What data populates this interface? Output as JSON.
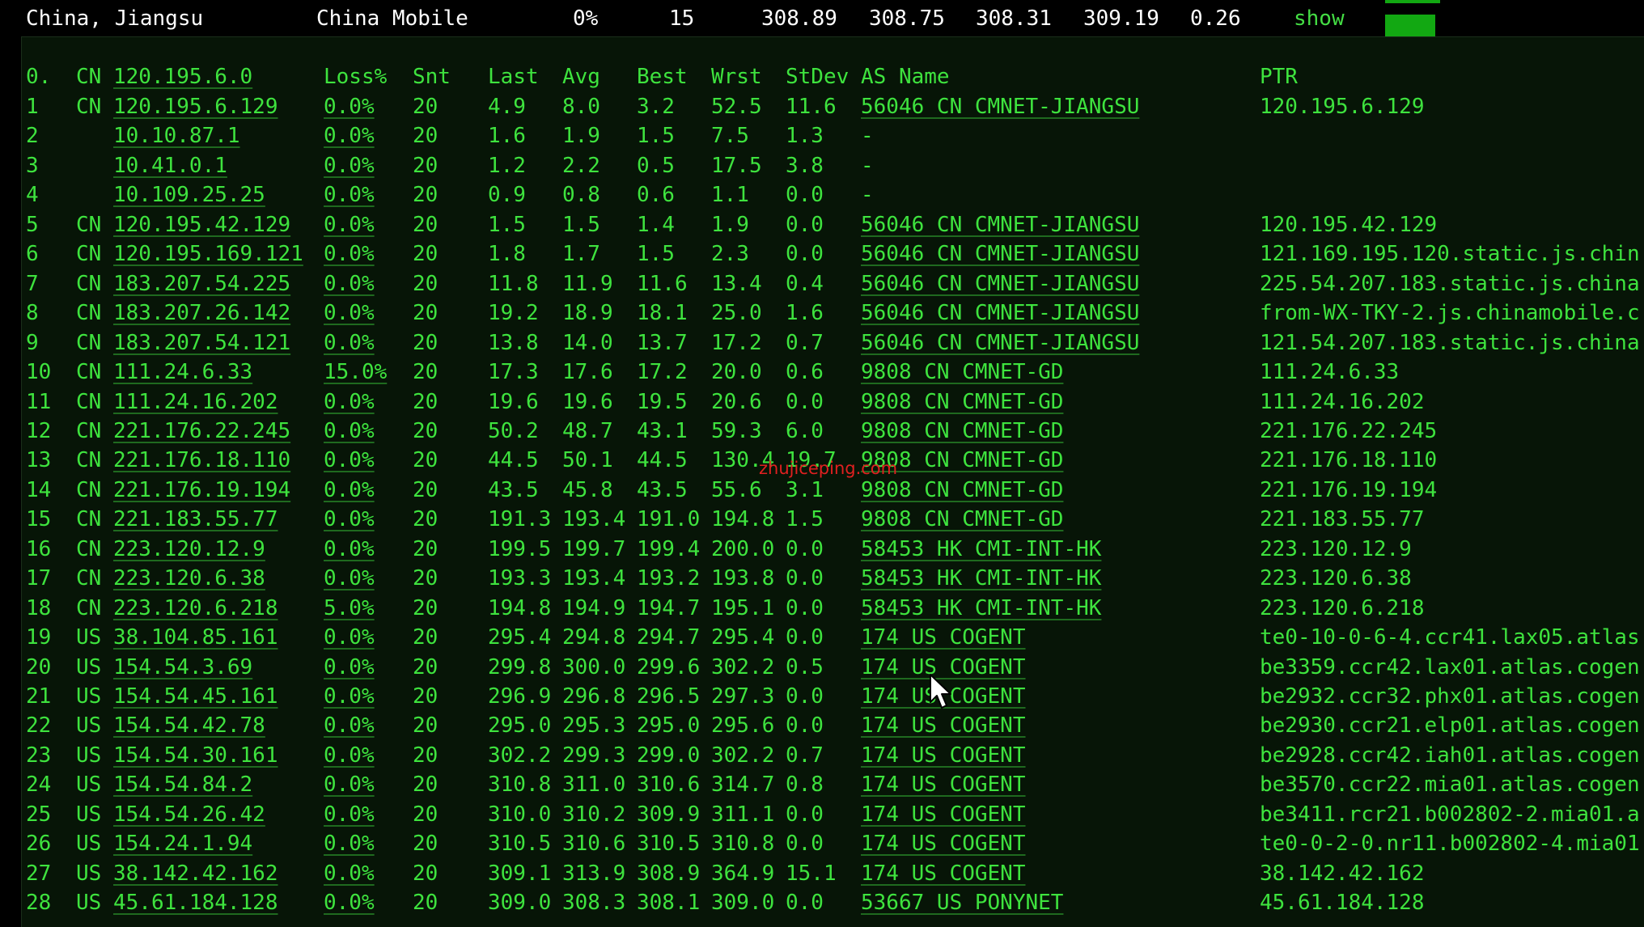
{
  "summary": {
    "location": "China, Jiangsu",
    "isp": "China Mobile",
    "loss": "0%",
    "sent": "15",
    "last": "308.89",
    "avg": "308.75",
    "best": "308.31",
    "worst": "309.19",
    "stdev": "0.26",
    "show_label": "show",
    "accent": "#12a812"
  },
  "trace": {
    "header": {
      "hop": "0.",
      "cc": "CN",
      "ip": "120.195.6.0",
      "loss": "Loss%",
      "snt": "Snt",
      "last": "Last",
      "avg": "Avg",
      "best": "Best",
      "wrst": "Wrst",
      "stdev": "StDev",
      "as": "AS Name",
      "ptr": "PTR"
    },
    "rows": [
      [
        "1",
        "CN",
        "120.195.6.129",
        "0.0%",
        "20",
        "4.9",
        "8.0",
        "3.2",
        "52.5",
        "11.6",
        "56046 CN CMNET-JIANGSU",
        "120.195.6.129"
      ],
      [
        "2",
        "",
        "10.10.87.1",
        "0.0%",
        "20",
        "1.6",
        "1.9",
        "1.5",
        "7.5",
        "1.3",
        "-",
        ""
      ],
      [
        "3",
        "",
        "10.41.0.1",
        "0.0%",
        "20",
        "1.2",
        "2.2",
        "0.5",
        "17.5",
        "3.8",
        "-",
        ""
      ],
      [
        "4",
        "",
        "10.109.25.25",
        "0.0%",
        "20",
        "0.9",
        "0.8",
        "0.6",
        "1.1",
        "0.0",
        "-",
        ""
      ],
      [
        "5",
        "CN",
        "120.195.42.129",
        "0.0%",
        "20",
        "1.5",
        "1.5",
        "1.4",
        "1.9",
        "0.0",
        "56046 CN CMNET-JIANGSU",
        "120.195.42.129"
      ],
      [
        "6",
        "CN",
        "120.195.169.121",
        "0.0%",
        "20",
        "1.8",
        "1.7",
        "1.5",
        "2.3",
        "0.0",
        "56046 CN CMNET-JIANGSU",
        "121.169.195.120.static.js.chin"
      ],
      [
        "7",
        "CN",
        "183.207.54.225",
        "0.0%",
        "20",
        "11.8",
        "11.9",
        "11.6",
        "13.4",
        "0.4",
        "56046 CN CMNET-JIANGSU",
        "225.54.207.183.static.js.china"
      ],
      [
        "8",
        "CN",
        "183.207.26.142",
        "0.0%",
        "20",
        "19.2",
        "18.9",
        "18.1",
        "25.0",
        "1.6",
        "56046 CN CMNET-JIANGSU",
        "from-WX-TKY-2.js.chinamobile.c"
      ],
      [
        "9",
        "CN",
        "183.207.54.121",
        "0.0%",
        "20",
        "13.8",
        "14.0",
        "13.7",
        "17.2",
        "0.7",
        "56046 CN CMNET-JIANGSU",
        "121.54.207.183.static.js.china"
      ],
      [
        "10",
        "CN",
        "111.24.6.33",
        "15.0%",
        "20",
        "17.3",
        "17.6",
        "17.2",
        "20.0",
        "0.6",
        "9808  CN CMNET-GD",
        "111.24.6.33"
      ],
      [
        "11",
        "CN",
        "111.24.16.202",
        "0.0%",
        "20",
        "19.6",
        "19.6",
        "19.5",
        "20.6",
        "0.0",
        "9808  CN CMNET-GD",
        "111.24.16.202"
      ],
      [
        "12",
        "CN",
        "221.176.22.245",
        "0.0%",
        "20",
        "50.2",
        "48.7",
        "43.1",
        "59.3",
        "6.0",
        "9808  CN CMNET-GD",
        "221.176.22.245"
      ],
      [
        "13",
        "CN",
        "221.176.18.110",
        "0.0%",
        "20",
        "44.5",
        "50.1",
        "44.5",
        "130.4",
        "19.7",
        "9808  CN CMNET-GD",
        "221.176.18.110"
      ],
      [
        "14",
        "CN",
        "221.176.19.194",
        "0.0%",
        "20",
        "43.5",
        "45.8",
        "43.5",
        "55.6",
        "3.1",
        "9808  CN CMNET-GD",
        "221.176.19.194"
      ],
      [
        "15",
        "CN",
        "221.183.55.77",
        "0.0%",
        "20",
        "191.3",
        "193.4",
        "191.0",
        "194.8",
        "1.5",
        "9808  CN CMNET-GD",
        "221.183.55.77"
      ],
      [
        "16",
        "CN",
        "223.120.12.9",
        "0.0%",
        "20",
        "199.5",
        "199.7",
        "199.4",
        "200.0",
        "0.0",
        "58453 HK CMI-INT-HK",
        "223.120.12.9"
      ],
      [
        "17",
        "CN",
        "223.120.6.38",
        "0.0%",
        "20",
        "193.3",
        "193.4",
        "193.2",
        "193.8",
        "0.0",
        "58453 HK CMI-INT-HK",
        "223.120.6.38"
      ],
      [
        "18",
        "CN",
        "223.120.6.218",
        "5.0%",
        "20",
        "194.8",
        "194.9",
        "194.7",
        "195.1",
        "0.0",
        "58453 HK CMI-INT-HK",
        "223.120.6.218"
      ],
      [
        "19",
        "US",
        "38.104.85.161",
        "0.0%",
        "20",
        "295.4",
        "294.8",
        "294.7",
        "295.4",
        "0.0",
        "174   US COGENT",
        "te0-10-0-6-4.ccr41.lax05.atlas"
      ],
      [
        "20",
        "US",
        "154.54.3.69",
        "0.0%",
        "20",
        "299.8",
        "300.0",
        "299.6",
        "302.2",
        "0.5",
        "174   US COGENT",
        "be3359.ccr42.lax01.atlas.cogen"
      ],
      [
        "21",
        "US",
        "154.54.45.161",
        "0.0%",
        "20",
        "296.9",
        "296.8",
        "296.5",
        "297.3",
        "0.0",
        "174   US COGENT",
        "be2932.ccr32.phx01.atlas.cogen"
      ],
      [
        "22",
        "US",
        "154.54.42.78",
        "0.0%",
        "20",
        "295.0",
        "295.3",
        "295.0",
        "295.6",
        "0.0",
        "174   US COGENT",
        "be2930.ccr21.elp01.atlas.cogen"
      ],
      [
        "23",
        "US",
        "154.54.30.161",
        "0.0%",
        "20",
        "302.2",
        "299.3",
        "299.0",
        "302.2",
        "0.7",
        "174   US COGENT",
        "be2928.ccr42.iah01.atlas.cogen"
      ],
      [
        "24",
        "US",
        "154.54.84.2",
        "0.0%",
        "20",
        "310.8",
        "311.0",
        "310.6",
        "314.7",
        "0.8",
        "174   US COGENT",
        "be3570.ccr22.mia01.atlas.cogen"
      ],
      [
        "25",
        "US",
        "154.54.26.42",
        "0.0%",
        "20",
        "310.0",
        "310.2",
        "309.9",
        "311.1",
        "0.0",
        "174   US COGENT",
        "be3411.rcr21.b002802-2.mia01.a"
      ],
      [
        "26",
        "US",
        "154.24.1.94",
        "0.0%",
        "20",
        "310.5",
        "310.6",
        "310.5",
        "310.8",
        "0.0",
        "174   US COGENT",
        "te0-0-2-0.nr11.b002802-4.mia01"
      ],
      [
        "27",
        "US",
        "38.142.42.162",
        "0.0%",
        "20",
        "309.1",
        "313.9",
        "308.9",
        "364.9",
        "15.1",
        "174   US COGENT",
        "38.142.42.162"
      ],
      [
        "28",
        "US",
        "45.61.184.128",
        "0.0%",
        "20",
        "309.0",
        "308.3",
        "308.1",
        "309.0",
        "0.0",
        "53667 US PONYNET",
        "45.61.184.128"
      ]
    ]
  },
  "watermark": "zhujiceping.com"
}
